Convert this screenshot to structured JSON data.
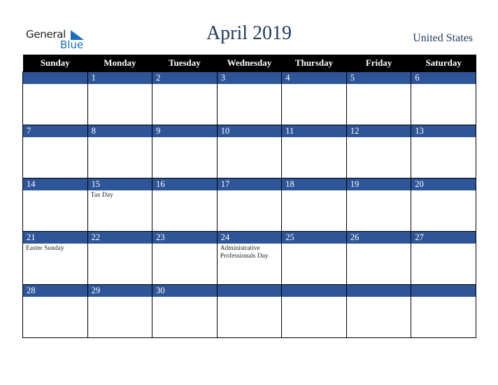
{
  "logo": {
    "word1": "General",
    "word2": "Blue"
  },
  "title": "April 2019",
  "country": "United States",
  "weekdays": [
    "Sunday",
    "Monday",
    "Tuesday",
    "Wednesday",
    "Thursday",
    "Friday",
    "Saturday"
  ],
  "weeks": [
    [
      {
        "d": "",
        "e": ""
      },
      {
        "d": "1",
        "e": ""
      },
      {
        "d": "2",
        "e": ""
      },
      {
        "d": "3",
        "e": ""
      },
      {
        "d": "4",
        "e": ""
      },
      {
        "d": "5",
        "e": ""
      },
      {
        "d": "6",
        "e": ""
      }
    ],
    [
      {
        "d": "7",
        "e": ""
      },
      {
        "d": "8",
        "e": ""
      },
      {
        "d": "9",
        "e": ""
      },
      {
        "d": "10",
        "e": ""
      },
      {
        "d": "11",
        "e": ""
      },
      {
        "d": "12",
        "e": ""
      },
      {
        "d": "13",
        "e": ""
      }
    ],
    [
      {
        "d": "14",
        "e": ""
      },
      {
        "d": "15",
        "e": "Tax Day"
      },
      {
        "d": "16",
        "e": ""
      },
      {
        "d": "17",
        "e": ""
      },
      {
        "d": "18",
        "e": ""
      },
      {
        "d": "19",
        "e": ""
      },
      {
        "d": "20",
        "e": ""
      }
    ],
    [
      {
        "d": "21",
        "e": "Easter Sunday"
      },
      {
        "d": "22",
        "e": ""
      },
      {
        "d": "23",
        "e": ""
      },
      {
        "d": "24",
        "e": "Administrative Professionals Day"
      },
      {
        "d": "25",
        "e": ""
      },
      {
        "d": "26",
        "e": ""
      },
      {
        "d": "27",
        "e": ""
      }
    ],
    [
      {
        "d": "28",
        "e": ""
      },
      {
        "d": "29",
        "e": ""
      },
      {
        "d": "30",
        "e": ""
      },
      {
        "d": "",
        "e": ""
      },
      {
        "d": "",
        "e": ""
      },
      {
        "d": "",
        "e": ""
      },
      {
        "d": "",
        "e": ""
      }
    ]
  ]
}
